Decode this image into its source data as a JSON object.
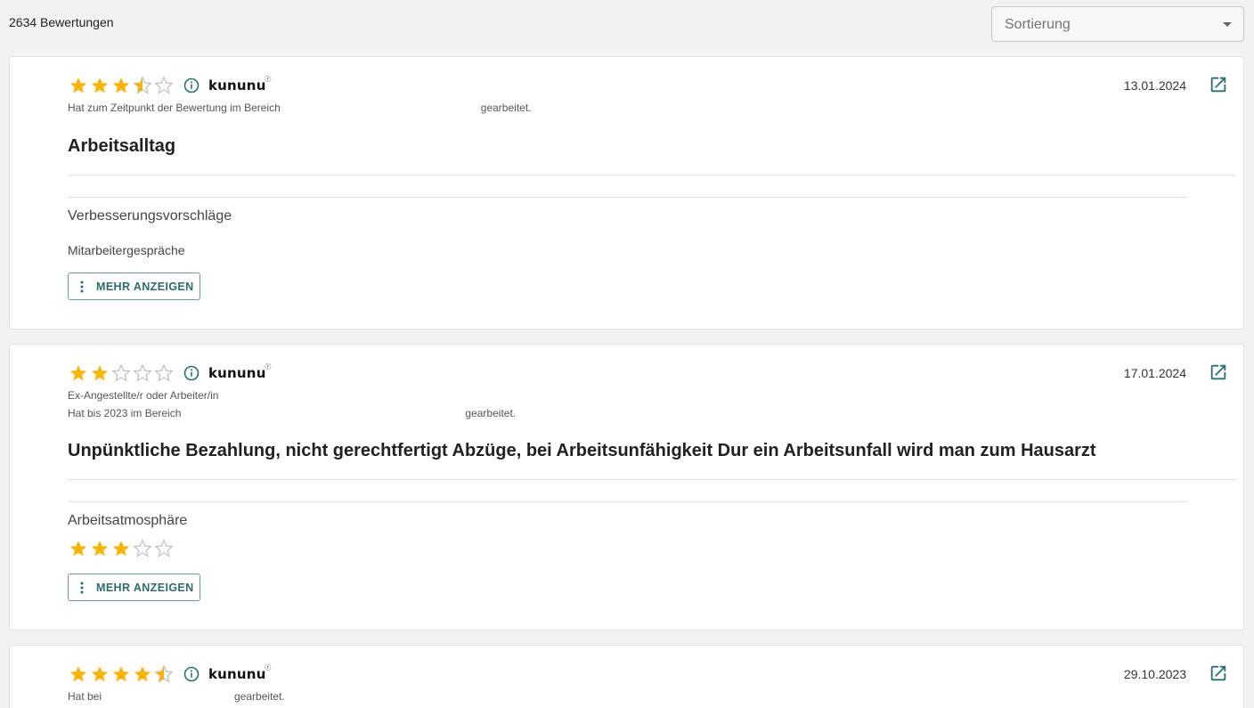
{
  "header": {
    "review_count": "2634 Bewertungen",
    "sort_placeholder": "Sortierung"
  },
  "colors": {
    "star_filled": "#f5b50a",
    "star_empty": "#bdbdbd",
    "accent": "#2f6b6e",
    "icon_teal": "#2a7071"
  },
  "icons": {
    "info": "info-circle-icon",
    "external": "external-link-icon",
    "more": "vertical-dots-icon",
    "dropdown": "caret-down-icon"
  },
  "reviews": [
    {
      "rating": 3.5,
      "source_logo": "kununu",
      "source_mark": "ⓡ",
      "date": "13.01.2024",
      "meta_line_1": "Hat zum Zeitpunkt der Bewertung im Bereich",
      "meta_line_1_end": "gearbeitet.",
      "title": "Arbeitsalltag",
      "section_label": "Verbesserungsvorschläge",
      "section_text": "Mitarbeitergespräche",
      "more_label": "MEHR ANZEIGEN"
    },
    {
      "rating": 2,
      "source_logo": "kununu",
      "source_mark": "ⓡ",
      "date": "17.01.2024",
      "meta_line_0": "Ex-Angestellte/r oder Arbeiter/in",
      "meta_line_1": "Hat bis 2023 im Bereich",
      "meta_line_1_end": "gearbeitet.",
      "title": "Unpünktliche Bezahlung, nicht gerechtfertigt Abzüge, bei Arbeitsunfähigkeit Dur ein Arbeitsunfall wird man zum Hausarzt",
      "section_label": "Arbeitsatmosphäre",
      "section_rating": 3,
      "more_label": "MEHR ANZEIGEN"
    },
    {
      "rating": 4.5,
      "source_logo": "kununu",
      "source_mark": "ⓡ",
      "date": "29.10.2023",
      "meta_line_1": "Hat bei",
      "meta_line_1_end": "gearbeitet."
    }
  ]
}
